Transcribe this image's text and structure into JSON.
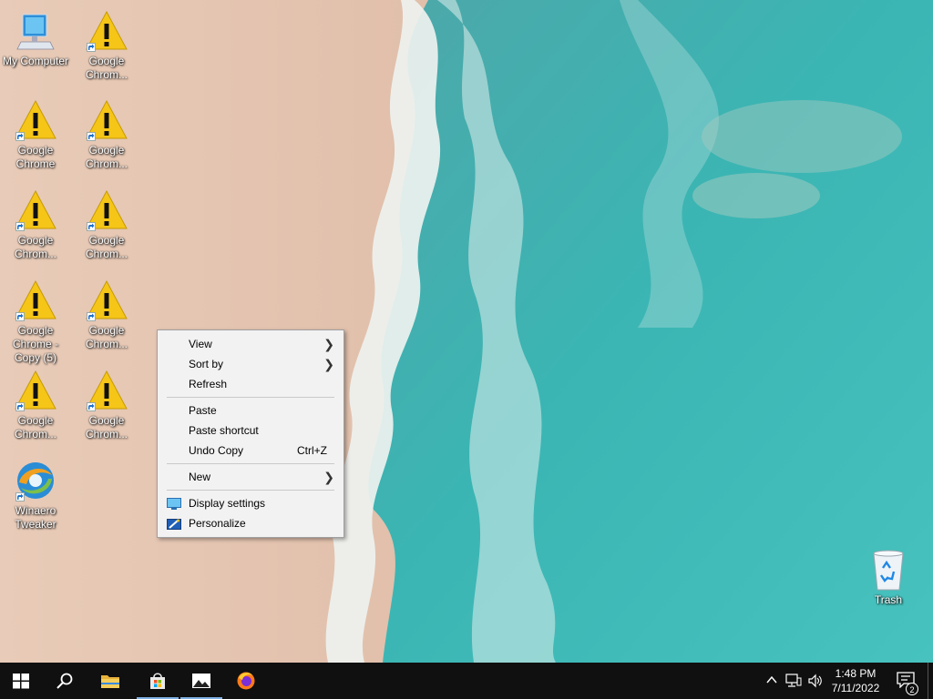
{
  "desktop_icons": [
    {
      "label": "My Computer",
      "kind": "computer-icon"
    },
    {
      "label": "Google Chrom...",
      "kind": "warning-icon"
    },
    {
      "label": "Google Chrome",
      "kind": "warning-icon"
    },
    {
      "label": "Google Chrom...",
      "kind": "warning-icon"
    },
    {
      "label": "Google Chrom...",
      "kind": "warning-icon"
    },
    {
      "label": "Google Chrom...",
      "kind": "warning-icon"
    },
    {
      "label": "Google Chrome - Copy (5)",
      "kind": "warning-icon"
    },
    {
      "label": "Google Chrom...",
      "kind": "warning-icon"
    },
    {
      "label": "Google Chrom...",
      "kind": "warning-icon"
    },
    {
      "label": "Google Chrom...",
      "kind": "warning-icon"
    },
    {
      "label": "Winaero Tweaker",
      "kind": "winaero-tweaker-icon"
    },
    {
      "label": "Trash",
      "kind": "recycle-bin-icon"
    }
  ],
  "context_menu": {
    "view": "View",
    "sort_by": "Sort by",
    "refresh": "Refresh",
    "paste": "Paste",
    "paste_shortcut": "Paste shortcut",
    "undo_copy": "Undo Copy",
    "undo_copy_shortcut": "Ctrl+Z",
    "new": "New",
    "display_settings": "Display settings",
    "personalize": "Personalize"
  },
  "taskbar": {
    "time": "1:48 PM",
    "date": "7/11/2022",
    "notification_count": "2",
    "pinned": [
      "start-icon",
      "search-icon",
      "file-explorer-icon",
      "store-icon",
      "photos-icon",
      "firefox-icon"
    ]
  },
  "colors": {
    "taskbar": "#101010",
    "menu_bg": "#f2f2f2",
    "warning_yellow": "#f5c518",
    "sea": "#3fb8b4",
    "sand": "#e2c3ae"
  }
}
